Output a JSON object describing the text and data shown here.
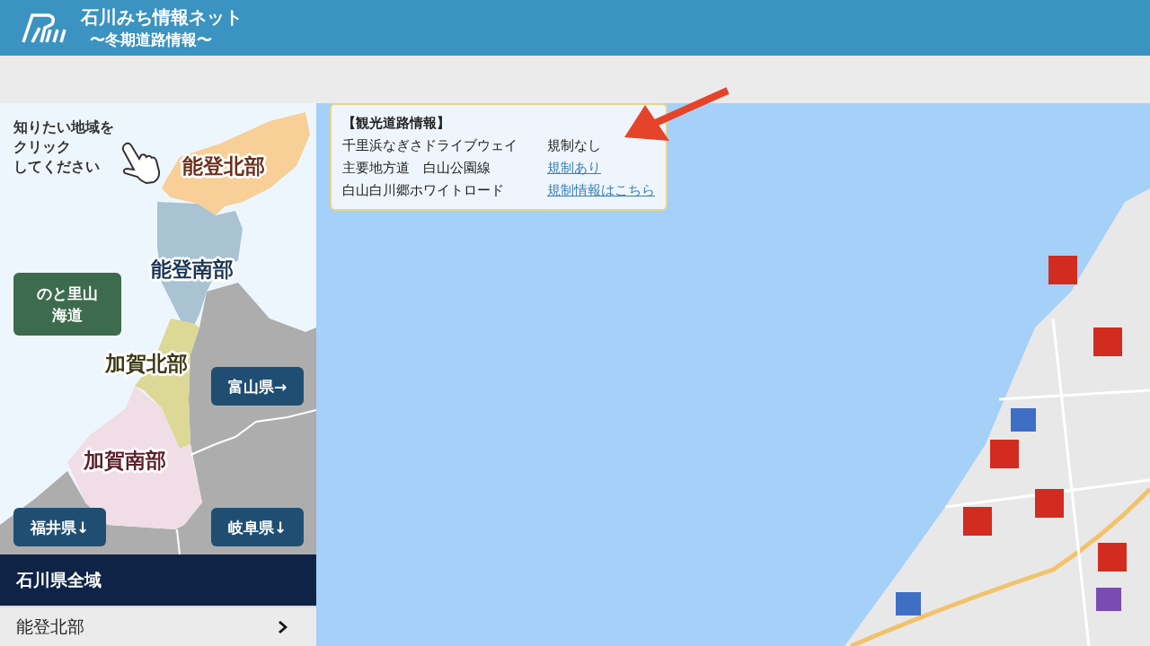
{
  "header": {
    "title": "石川みち情報ネット",
    "subtitle": "〜冬期道路情報〜"
  },
  "region_map": {
    "hint": [
      "知りたい地域を",
      "クリック",
      "してください"
    ],
    "regions": [
      {
        "label": "能登北部",
        "color": "#f8cf96"
      },
      {
        "label": "能登南部",
        "color": "#a9c3d3"
      },
      {
        "label": "加賀北部",
        "color": "#dcd896"
      },
      {
        "label": "加賀南部",
        "color": "#f1dde5"
      }
    ],
    "buttons": [
      {
        "label": "のと里山海道",
        "kind": "route"
      },
      {
        "label": "富山県→",
        "kind": "prefecture"
      },
      {
        "label": "福井県↓",
        "kind": "prefecture"
      },
      {
        "label": "岐阜県↓",
        "kind": "prefecture"
      }
    ]
  },
  "tourist_roads": {
    "title": "【観光道路情報】",
    "rows": [
      {
        "road": "千里浜なぎさドライブウェイ",
        "status": "規制なし",
        "kind": "text"
      },
      {
        "road": "主要地方道　白山公園線",
        "status": "規制あり",
        "kind": "link"
      },
      {
        "road": "白山白川郷ホワイトロード",
        "status": "規制情報はこちら",
        "kind": "link"
      }
    ]
  },
  "area_list": {
    "header": "石川県全域",
    "items": [
      {
        "label": "能登北部"
      }
    ]
  }
}
